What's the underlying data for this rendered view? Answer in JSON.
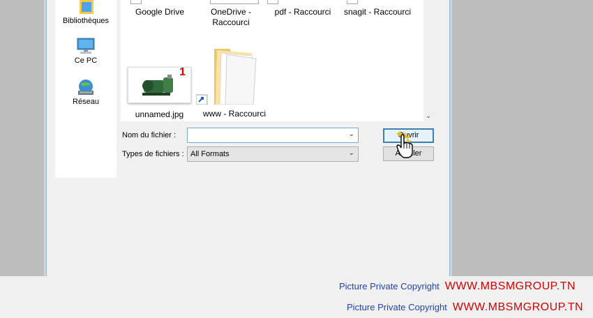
{
  "nav": {
    "items": [
      {
        "label": "Bibliothèques",
        "icon": "libraries-icon"
      },
      {
        "label": "Ce PC",
        "icon": "computer-icon"
      },
      {
        "label": "Réseau",
        "icon": "network-icon"
      }
    ]
  },
  "files": [
    {
      "name": "Google Drive"
    },
    {
      "name": "OneDrive -\nRaccourci"
    },
    {
      "name": "pdf - Raccourci"
    },
    {
      "name": "snagit - Raccourci"
    },
    {
      "name": "unnamed.jpg",
      "badge": "1"
    },
    {
      "name": "www - Raccourci"
    }
  ],
  "form": {
    "filename_label": "Nom du fichier :",
    "filename_value": "",
    "filetype_label": "Types de fichiers :",
    "filetype_value": "All Formats"
  },
  "buttons": {
    "open": "Ouvrir",
    "cancel": "Annuler"
  },
  "footer": {
    "line1_text": "Picture Private Copyright",
    "line1_site": "WWW.MBSMGROUP.TN",
    "line2_text": "Picture Private Copyright",
    "line2_site": "WWW.MBSMGROUP.TN"
  },
  "colors": {
    "accent": "#3c7fb1",
    "watermark_red": "#d40000",
    "watermark_blue": "#2244aa"
  }
}
